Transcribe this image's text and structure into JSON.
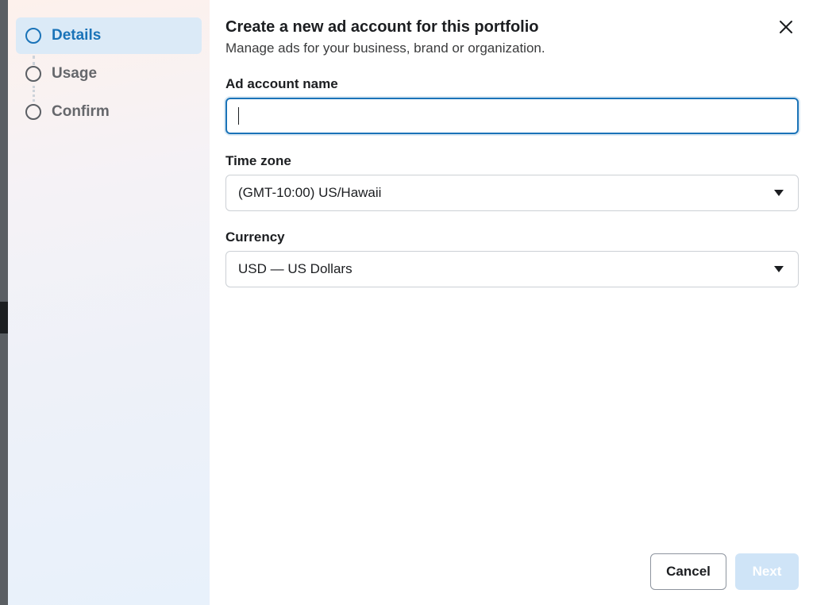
{
  "sidebar": {
    "steps": [
      {
        "label": "Details"
      },
      {
        "label": "Usage"
      },
      {
        "label": "Confirm"
      }
    ]
  },
  "dialog": {
    "title": "Create a new ad account for this portfolio",
    "subtitle": "Manage ads for your business, brand or organization."
  },
  "form": {
    "ad_account_name": {
      "label": "Ad account name",
      "value": ""
    },
    "time_zone": {
      "label": "Time zone",
      "value": "(GMT-10:00) US/Hawaii"
    },
    "currency": {
      "label": "Currency",
      "value": "USD — US Dollars"
    }
  },
  "footer": {
    "cancel_label": "Cancel",
    "next_label": "Next"
  },
  "colors": {
    "accent": "#1a73b8",
    "active_step_bg": "#dbeaf7",
    "disabled_button_bg": "#cfe4f7"
  },
  "icons": {
    "close": "close-icon",
    "dropdown": "caret-down-icon",
    "step": "step-circle-icon"
  }
}
